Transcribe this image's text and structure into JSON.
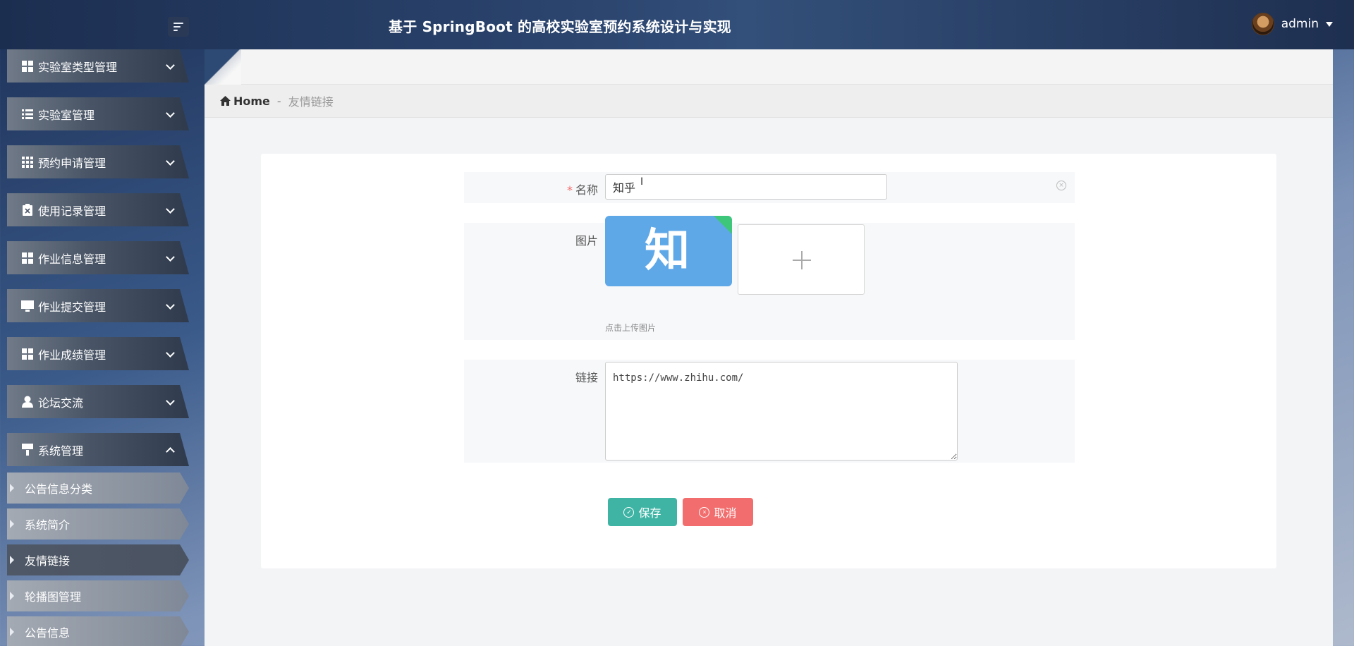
{
  "header": {
    "title": "基于 SpringBoot 的高校实验室预约系统设计与实现",
    "user_name": "admin"
  },
  "sidebar": {
    "menus": [
      {
        "label": "实验室类型管理",
        "icon": "grid-icon"
      },
      {
        "label": "实验室管理",
        "icon": "list-icon"
      },
      {
        "label": "预约申请管理",
        "icon": "grid9-icon"
      },
      {
        "label": "使用记录管理",
        "icon": "clipboard-icon"
      },
      {
        "label": "作业信息管理",
        "icon": "grid-icon"
      },
      {
        "label": "作业提交管理",
        "icon": "monitor-icon"
      },
      {
        "label": "作业成绩管理",
        "icon": "grid-icon"
      },
      {
        "label": "论坛交流",
        "icon": "user-icon"
      },
      {
        "label": "系统管理",
        "icon": "brush-icon"
      }
    ],
    "sub_items": [
      {
        "label": "公告信息分类"
      },
      {
        "label": "系统简介"
      },
      {
        "label": "友情链接"
      },
      {
        "label": "轮播图管理"
      },
      {
        "label": "公告信息"
      }
    ],
    "active_sub": "友情链接"
  },
  "breadcrumb": {
    "home": "Home",
    "separator": "-",
    "current": "友情链接"
  },
  "form": {
    "name": {
      "label": "名称",
      "required_mark": "*",
      "value": "知乎"
    },
    "image": {
      "label": "图片",
      "thumb_text": "知",
      "upload_tip": "点击上传图片"
    },
    "link": {
      "label": "链接",
      "value": "https://www.zhihu.com/"
    },
    "buttons": {
      "save": "保存",
      "cancel": "取消"
    }
  },
  "colors": {
    "save": "#3fb4a5",
    "cancel": "#f26e6e",
    "required": "#f56c6c"
  }
}
